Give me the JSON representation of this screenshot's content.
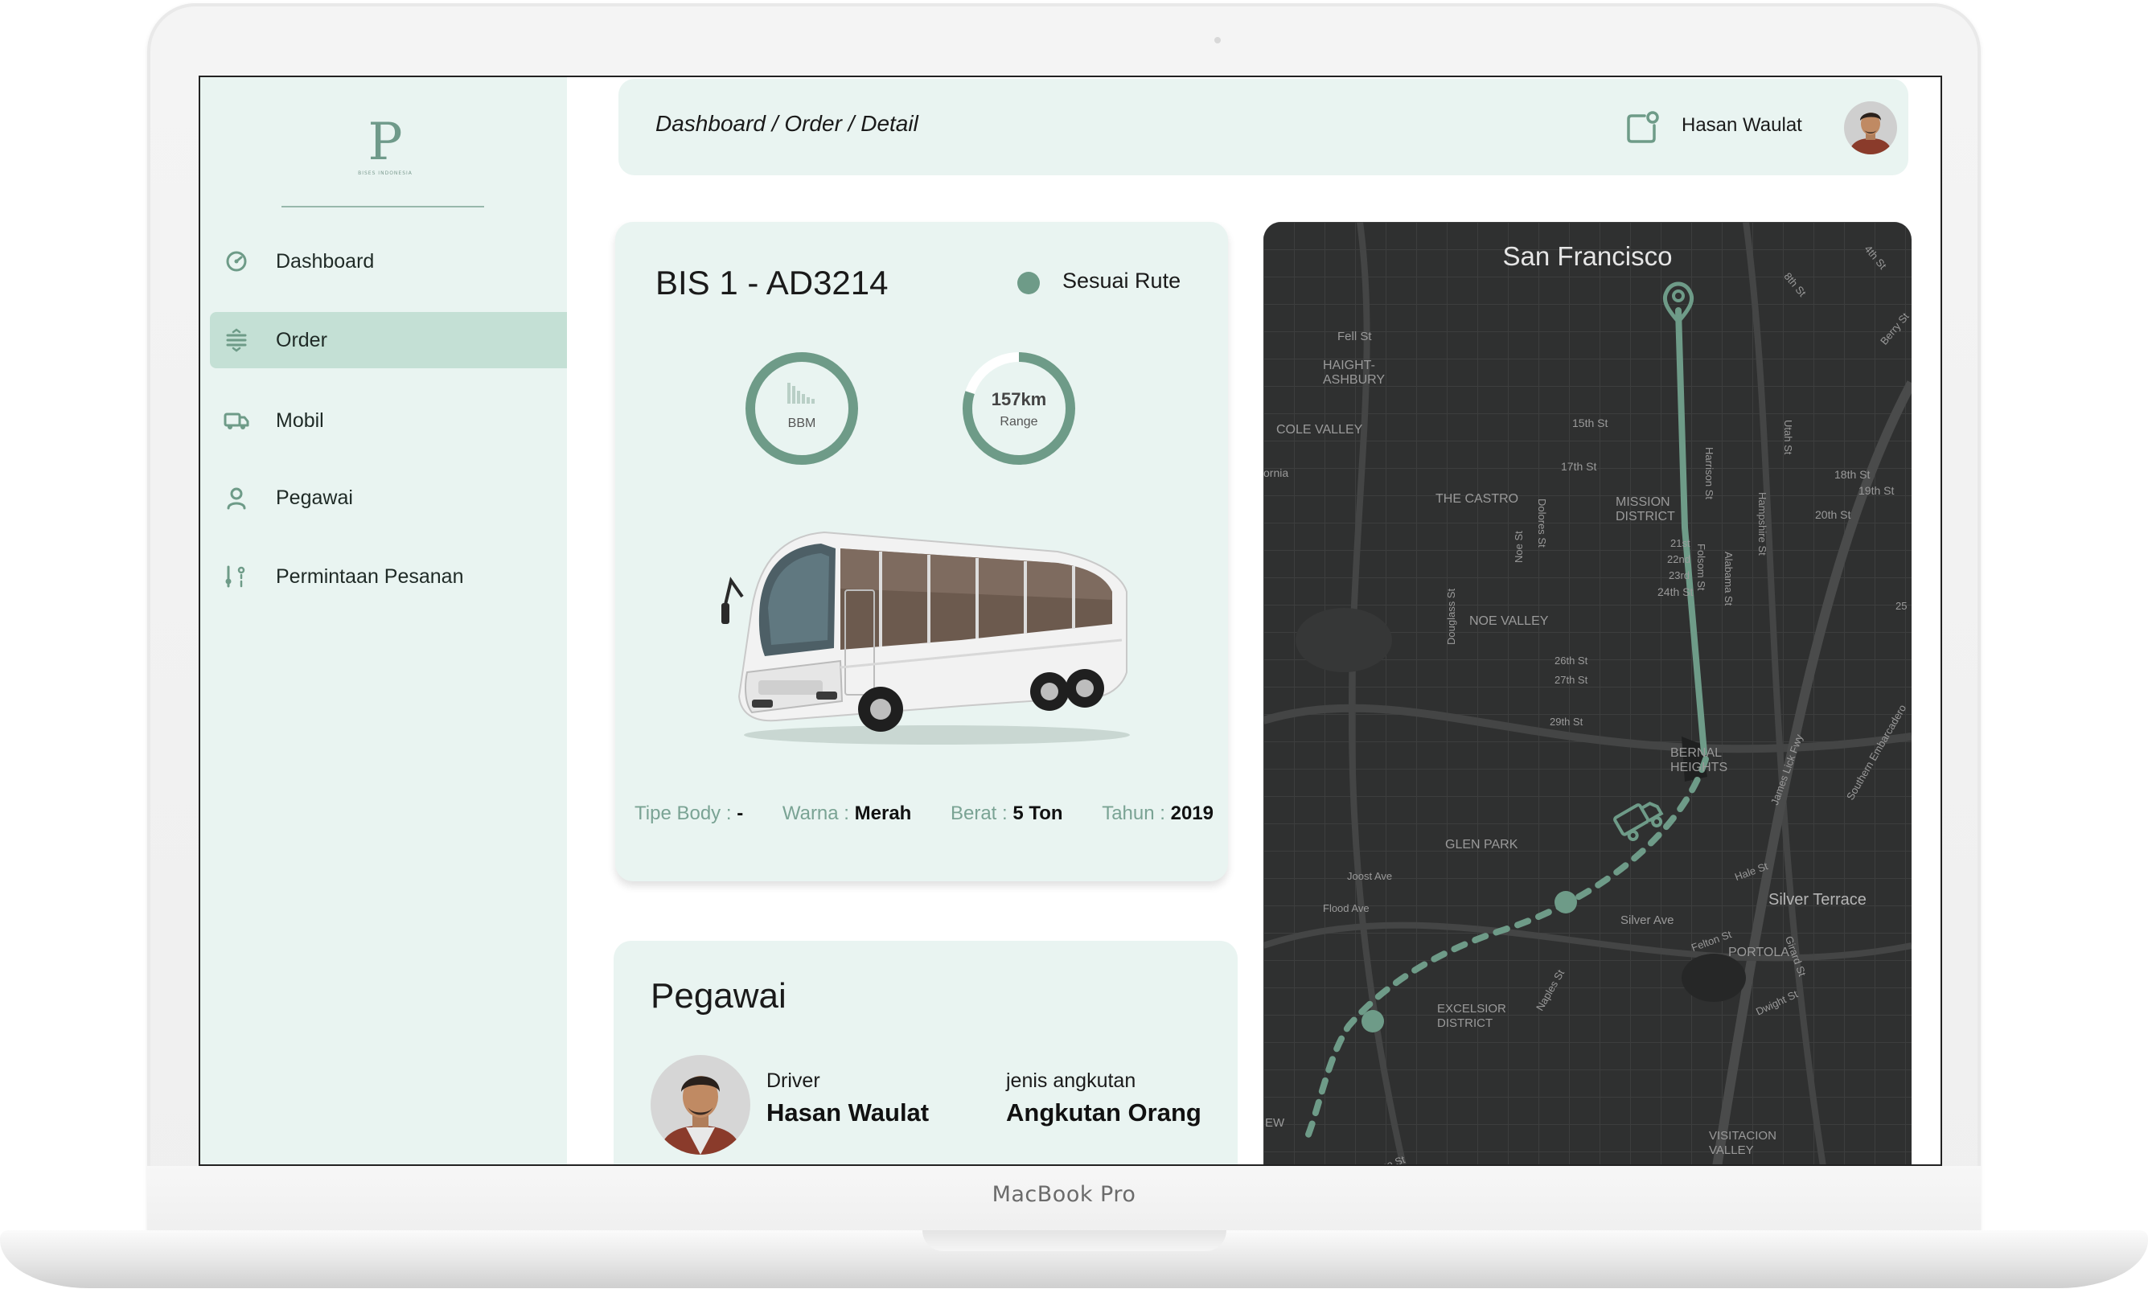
{
  "laptop": {
    "model_label": "MacBook Pro"
  },
  "sidebar": {
    "logo": {
      "mark": "P",
      "subtitle": "BISES INDONESIA"
    },
    "items": [
      {
        "label": "Dashboard",
        "icon": "speedometer-icon",
        "active": false
      },
      {
        "label": "Order",
        "icon": "filter-lines-icon",
        "active": true
      },
      {
        "label": "Mobil",
        "icon": "truck-icon",
        "active": false
      },
      {
        "label": "Pegawai",
        "icon": "user-icon",
        "active": false
      },
      {
        "label": "Permintaan Pesanan",
        "icon": "request-list-icon",
        "active": false
      }
    ]
  },
  "header": {
    "breadcrumb": "Dashboard / Order / Detail",
    "user_name": "Hasan Waulat",
    "notification_icon": "notification-icon"
  },
  "bus_card": {
    "title": "BIS 1 - AD3214",
    "status": "Sesuai Rute",
    "status_color": "#6e9b88",
    "fuel": {
      "label": "BBM",
      "fraction": 1.0
    },
    "range": {
      "value": "157km",
      "label": "Range",
      "fraction": 0.8
    },
    "specs": [
      {
        "key": "Tipe Body :",
        "value": "-"
      },
      {
        "key": "Warna :",
        "value": "Merah"
      },
      {
        "key": "Berat :",
        "value": "5 Ton"
      },
      {
        "key": "Tahun :",
        "value": "2019"
      }
    ]
  },
  "staff_card": {
    "title": "Pegawai",
    "role_label": "Driver",
    "name": "Hasan Waulat",
    "transport_label": "jenis angkutan",
    "transport_value": "Angkutan Orang"
  },
  "map": {
    "title": "San Francisco",
    "labels": [
      "Fell St",
      "HAIGHT-ASHBURY",
      "COLE VALLEY",
      "THE CASTRO",
      "MISSION DISTRICT",
      "NOE VALLEY",
      "15th St",
      "17th St",
      "18th St",
      "19th St",
      "20th St",
      "21st",
      "22nd",
      "23rd",
      "24th St",
      "26th St",
      "27th St",
      "29th St",
      "BERNAL HEIGHTS",
      "GLEN PARK",
      "Joost Ave",
      "Flood Ave",
      "Silver Ave",
      "Silver Terrace",
      "PORTOLA",
      "EXCELSIOR DISTRICT",
      "VISITACION VALLEY",
      "Dolores St",
      "Harrison St",
      "Folsom St",
      "Alabama St",
      "Hampshire St",
      "Noe St",
      "Douglass St",
      "Utah St",
      "Hale St",
      "Felton St",
      "Girard St",
      "Dwight St",
      "Naples St",
      "Morse St",
      "4th St",
      "8th St",
      "Berry St",
      "James Lick Fwy",
      "Southern Embarcadero",
      "ornia",
      "EW",
      "25"
    ],
    "colors": {
      "background": "#2f3030",
      "route": "#6e9b88"
    }
  },
  "colors": {
    "accent": "#6e9b88",
    "panel": "#e9f4f1",
    "active_nav": "#c4e0d5"
  }
}
